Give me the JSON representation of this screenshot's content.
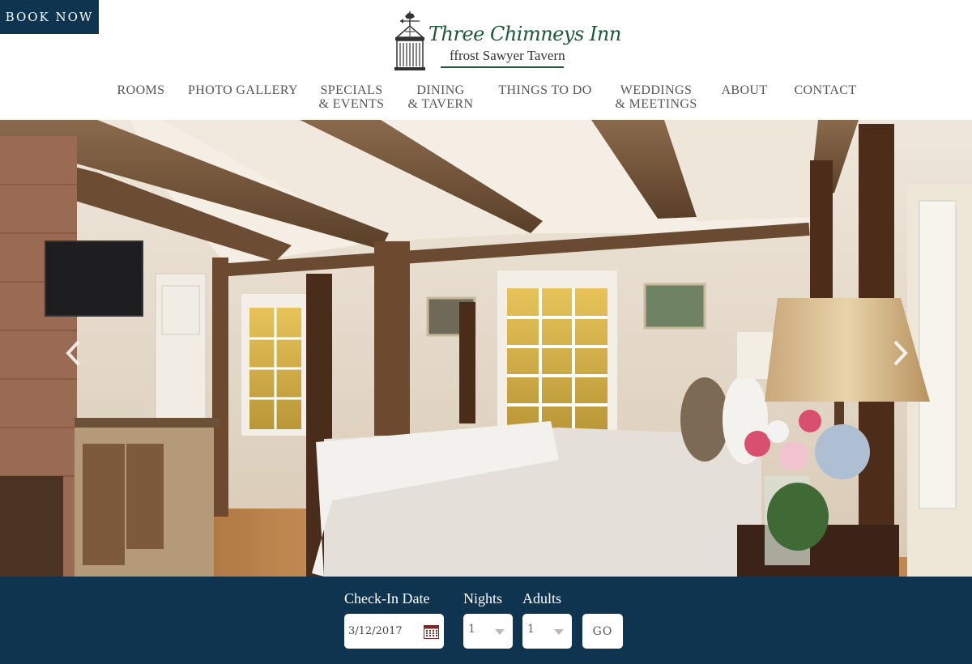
{
  "header": {
    "book_now": "BOOK NOW",
    "logo_title": "Three Chimneys Inn",
    "logo_subtitle": "ffrost Sawyer Tavern"
  },
  "nav": {
    "items": [
      {
        "label": "ROOMS"
      },
      {
        "label": "PHOTO GALLERY"
      },
      {
        "label": "SPECIALS\n& EVENTS"
      },
      {
        "label": "DINING\n& TAVERN"
      },
      {
        "label": "THINGS TO DO"
      },
      {
        "label": "WEDDINGS\n& MEETINGS"
      },
      {
        "label": "ABOUT"
      },
      {
        "label": "CONTACT"
      }
    ]
  },
  "hero": {
    "prev_icon": "chevron-left-icon",
    "next_icon": "chevron-right-icon"
  },
  "booking": {
    "checkin_label": "Check-In Date",
    "checkin_value": "3/12/2017",
    "nights_label": "Nights",
    "nights_value": "1",
    "adults_label": "Adults",
    "adults_value": "1",
    "go_label": "GO"
  },
  "colors": {
    "brand_navy": "#0e3450",
    "logo_green": "#1d5a34"
  }
}
